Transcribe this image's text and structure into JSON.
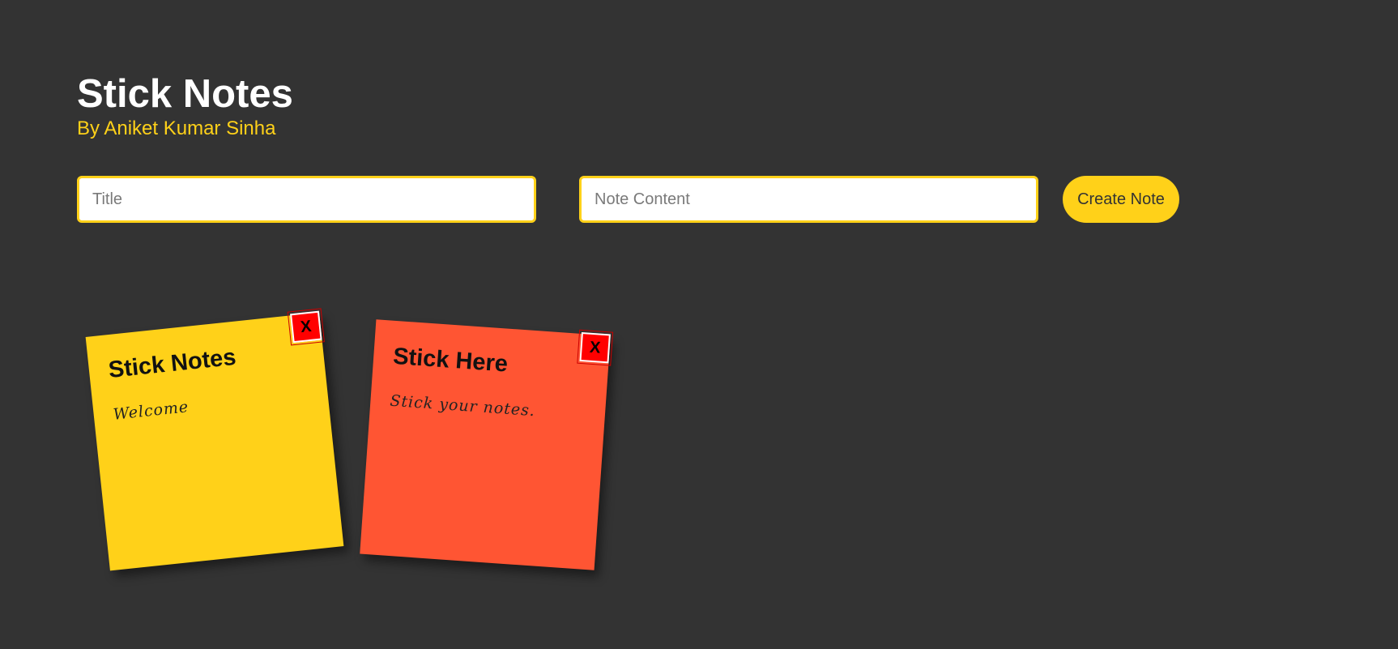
{
  "header": {
    "title": "Stick Notes",
    "subtitle": "By Aniket Kumar Sinha"
  },
  "form": {
    "title_placeholder": "Title",
    "content_placeholder": "Note Content",
    "create_button_label": "Create Note"
  },
  "notes": [
    {
      "title": "Stick Notes",
      "content": "Welcome",
      "color": "#ffd119",
      "delete_label": "X"
    },
    {
      "title": "Stick Here",
      "content": "Stick your notes.",
      "color": "#ff5533",
      "delete_label": "X"
    }
  ],
  "colors": {
    "background": "#333333",
    "accent": "#ffd119",
    "delete": "#ff0000"
  }
}
